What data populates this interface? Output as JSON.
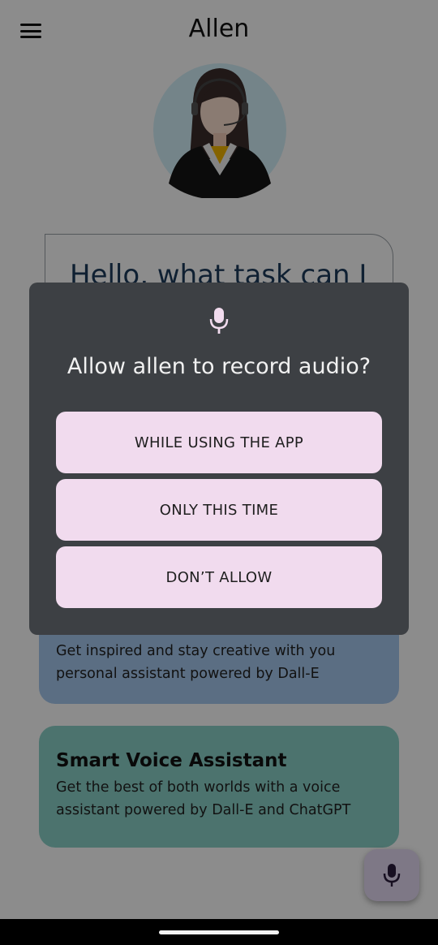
{
  "app": {
    "title": "Allen",
    "greeting": "Hello, what task can I",
    "features": [
      {
        "title": "",
        "description": "Get inspired and stay creative with you personal assistant powered by Dall-E"
      },
      {
        "title": "Smart Voice Assistant",
        "description": "Get the best of both worlds with a voice assistant powered by Dall-E and ChatGPT"
      }
    ],
    "icons": {
      "menu": "hamburger-menu-icon",
      "avatar": "assistant-avatar",
      "fab": "microphone-icon"
    }
  },
  "dialog": {
    "icon": "microphone-icon",
    "title": "Allow allen to record audio?",
    "buttons": [
      "WHILE USING THE APP",
      "ONLY THIS TIME",
      "DON’T ALLOW"
    ]
  },
  "colors": {
    "dialog_bg": "#3d4044",
    "button_bg": "#f1dbee",
    "card_dalle": "#a7c9ee",
    "card_voice": "#8bd2c8",
    "fab_bg": "#e6daf5"
  }
}
